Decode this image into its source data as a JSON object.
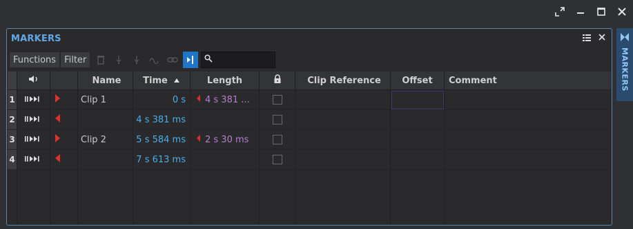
{
  "window": {
    "controls": [
      "expand-icon",
      "minimize-icon",
      "maximize-icon",
      "close-icon"
    ]
  },
  "panel": {
    "title": "MARKERS",
    "side_tab_label": "MARKERS"
  },
  "toolbar": {
    "functions_label": "Functions",
    "filter_label": "Filter",
    "search_value": ""
  },
  "columns": {
    "name": "Name",
    "time": "Time",
    "length": "Length",
    "clip_reference": "Clip Reference",
    "offset": "Offset",
    "comment": "Comment"
  },
  "rows": [
    {
      "num": "1",
      "marker": "start",
      "name": "Clip 1",
      "time": "0 s",
      "length": "4 s 381 ...",
      "has_length": true
    },
    {
      "num": "2",
      "marker": "end",
      "name": "",
      "time": "4 s 381 ms",
      "length": "",
      "has_length": false
    },
    {
      "num": "3",
      "marker": "start",
      "name": "Clip 2",
      "time": "5 s 584 ms",
      "length": "2 s 30 ms",
      "has_length": true
    },
    {
      "num": "4",
      "marker": "end",
      "name": "",
      "time": "7 s 613 ms",
      "length": "",
      "has_length": false
    }
  ],
  "colors": {
    "accent": "#1f76c8",
    "title": "#5fa8e8",
    "time": "#4aaee8",
    "length": "#b77cd3",
    "marker": "#e0322d"
  }
}
